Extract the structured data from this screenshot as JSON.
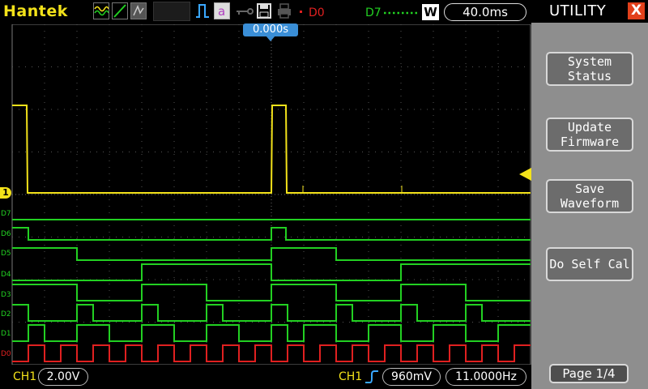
{
  "brand": "Hantek",
  "header": {
    "trigger_source_label": "D0",
    "channel_range_label": "D7",
    "window_badge": "W",
    "time_per_div": "40.0ms",
    "trigger_position": "0.000s"
  },
  "icons": {
    "mode_icons": [
      "waveform-mode-icon",
      "line-mode-icon",
      "persist-mode-icon"
    ],
    "tool_icons": [
      "pulse-icon",
      "a-icon",
      "key-icon",
      "save-icon",
      "print-icon"
    ]
  },
  "colors": {
    "ch1": "#f3e21a",
    "digital": "#22d022",
    "d0": "#e02020",
    "sidebar": "#8e8e8e"
  },
  "digital_channels": [
    "D7",
    "D6",
    "D5",
    "D4",
    "D3",
    "D2",
    "D1",
    "D0"
  ],
  "ch1_marker": "1",
  "footer": {
    "ch1_label": "CH1",
    "ch1_scale": "2.00V",
    "trig_channel": "CH1",
    "trig_level": "960mV",
    "frequency": "11.0000Hz"
  },
  "sidebar": {
    "title": "UTILITY",
    "close_symbol": "X",
    "buttons": [
      {
        "label": "System\nStatus"
      },
      {
        "label": "Update\nFirmware"
      },
      {
        "label": "Save\nWaveform"
      },
      {
        "label": "Do Self Cal"
      }
    ],
    "page": "Page 1/4"
  }
}
